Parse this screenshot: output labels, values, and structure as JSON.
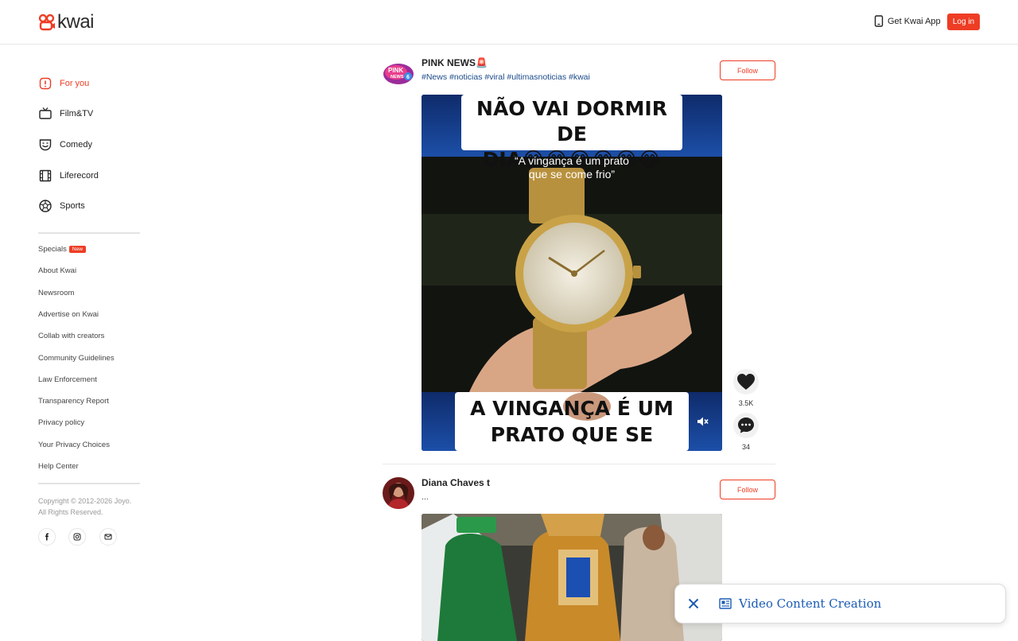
{
  "header": {
    "logo_text": "kwai",
    "get_app_label": "Get Kwai App",
    "login_label": "Log in",
    "brand_color": "#ee3d24"
  },
  "sidebar": {
    "nav": [
      {
        "label": "For you",
        "icon": "for-you-icon",
        "active": true
      },
      {
        "label": "Film&TV",
        "icon": "tv-icon",
        "active": false
      },
      {
        "label": "Comedy",
        "icon": "comedy-mask-icon",
        "active": false
      },
      {
        "label": "Liferecord",
        "icon": "film-strip-icon",
        "active": false
      },
      {
        "label": "Sports",
        "icon": "soccer-ball-icon",
        "active": false
      }
    ],
    "specials_label": "Specials",
    "specials_badge": "New",
    "links": [
      "About Kwai",
      "Newsroom",
      "Advertise on Kwai",
      "Collab with creators",
      "Community Guidelines",
      "Law Enforcement",
      "Transparency Report",
      "Privacy policy",
      "Your Privacy Choices",
      "Help Center"
    ],
    "copyright_line1": "Copyright © 2012-2026 Joyo.",
    "copyright_line2": "All Rights Reserved.",
    "social": [
      "facebook-icon",
      "instagram-icon",
      "email-icon"
    ]
  },
  "feed": {
    "posts": [
      {
        "author": "PINK NEWS🚨",
        "caption": "#News #noticias #viral #ultimasnoticias #kwai",
        "follow_label": "Follow",
        "video_top_text_1": "NÃO VAI DORMIR DE",
        "video_top_text_2": "DIA😂😂😂😂😂😂",
        "video_quote_1": "“A vingança é um prato",
        "video_quote_2": "que se come frio”",
        "video_bottom_text_1": "A VINGANÇA É UM",
        "video_bottom_text_2": "PRATO QUE SE COME",
        "likes": "3.5K",
        "comments": "34"
      },
      {
        "author": "Diana Chaves t",
        "caption": "...",
        "follow_label": "Follow"
      }
    ]
  },
  "popup": {
    "label": "Video Content Creation"
  }
}
